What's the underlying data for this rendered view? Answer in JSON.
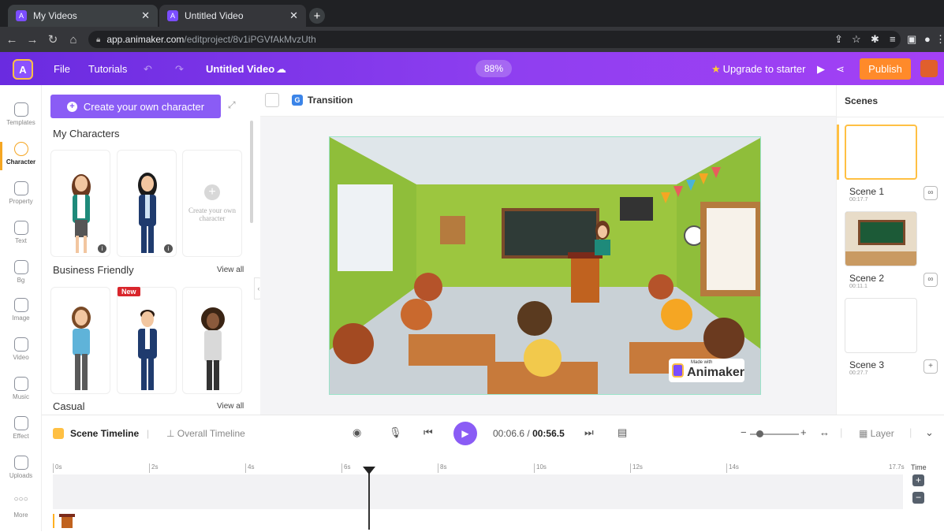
{
  "browser": {
    "tabs": [
      {
        "title": "My Videos"
      },
      {
        "title": "Untitled Video"
      }
    ],
    "url_host": "app.animaker.com",
    "url_path": "/editproject/8v1iPGVfAkMvzUth"
  },
  "header": {
    "file": "File",
    "tutorials": "Tutorials",
    "project_title": "Untitled Video",
    "zoom": "88%",
    "upgrade": "Upgrade to starter",
    "publish": "Publish"
  },
  "rail": [
    {
      "label": "Templates",
      "icon": "templates-icon"
    },
    {
      "label": "Character",
      "icon": "character-icon"
    },
    {
      "label": "Property",
      "icon": "property-icon"
    },
    {
      "label": "Text",
      "icon": "text-icon"
    },
    {
      "label": "Bg",
      "icon": "background-icon"
    },
    {
      "label": "Image",
      "icon": "image-icon"
    },
    {
      "label": "Video",
      "icon": "video-icon"
    },
    {
      "label": "Music",
      "icon": "music-icon"
    },
    {
      "label": "Effect",
      "icon": "effect-icon"
    },
    {
      "label": "Uploads",
      "icon": "uploads-icon"
    },
    {
      "label": "More",
      "icon": "more-icon"
    }
  ],
  "panel": {
    "create_button": "Create your own character",
    "my_characters": "My Characters",
    "create_card": "Create your own character",
    "business_friendly": "Business Friendly",
    "view_all": "View all",
    "new_badge": "New",
    "casual": "Casual"
  },
  "canvas": {
    "transition": "Transition",
    "watermark_small": "Made with",
    "watermark_big": "Animaker"
  },
  "scenes": {
    "title": "Scenes",
    "items": [
      {
        "name": "Scene 1",
        "time": "00:17.7"
      },
      {
        "name": "Scene 2",
        "time": "00:11.1"
      },
      {
        "name": "Scene 3",
        "time": "00:27.7"
      }
    ]
  },
  "timeline": {
    "scene_timeline": "Scene Timeline",
    "overall_timeline": "Overall Timeline",
    "current_time": "00:06.6",
    "total_time": "00:56.5",
    "layer": "Layer",
    "ticks": [
      "0s",
      "2s",
      "4s",
      "6s",
      "8s",
      "10s",
      "12s",
      "14s",
      "17.7s"
    ],
    "time_label": "Time"
  },
  "colors": {
    "brand_purple": "#8a5cf5",
    "publish_orange": "#ff8a2a",
    "accent_yellow": "#ffc043"
  }
}
